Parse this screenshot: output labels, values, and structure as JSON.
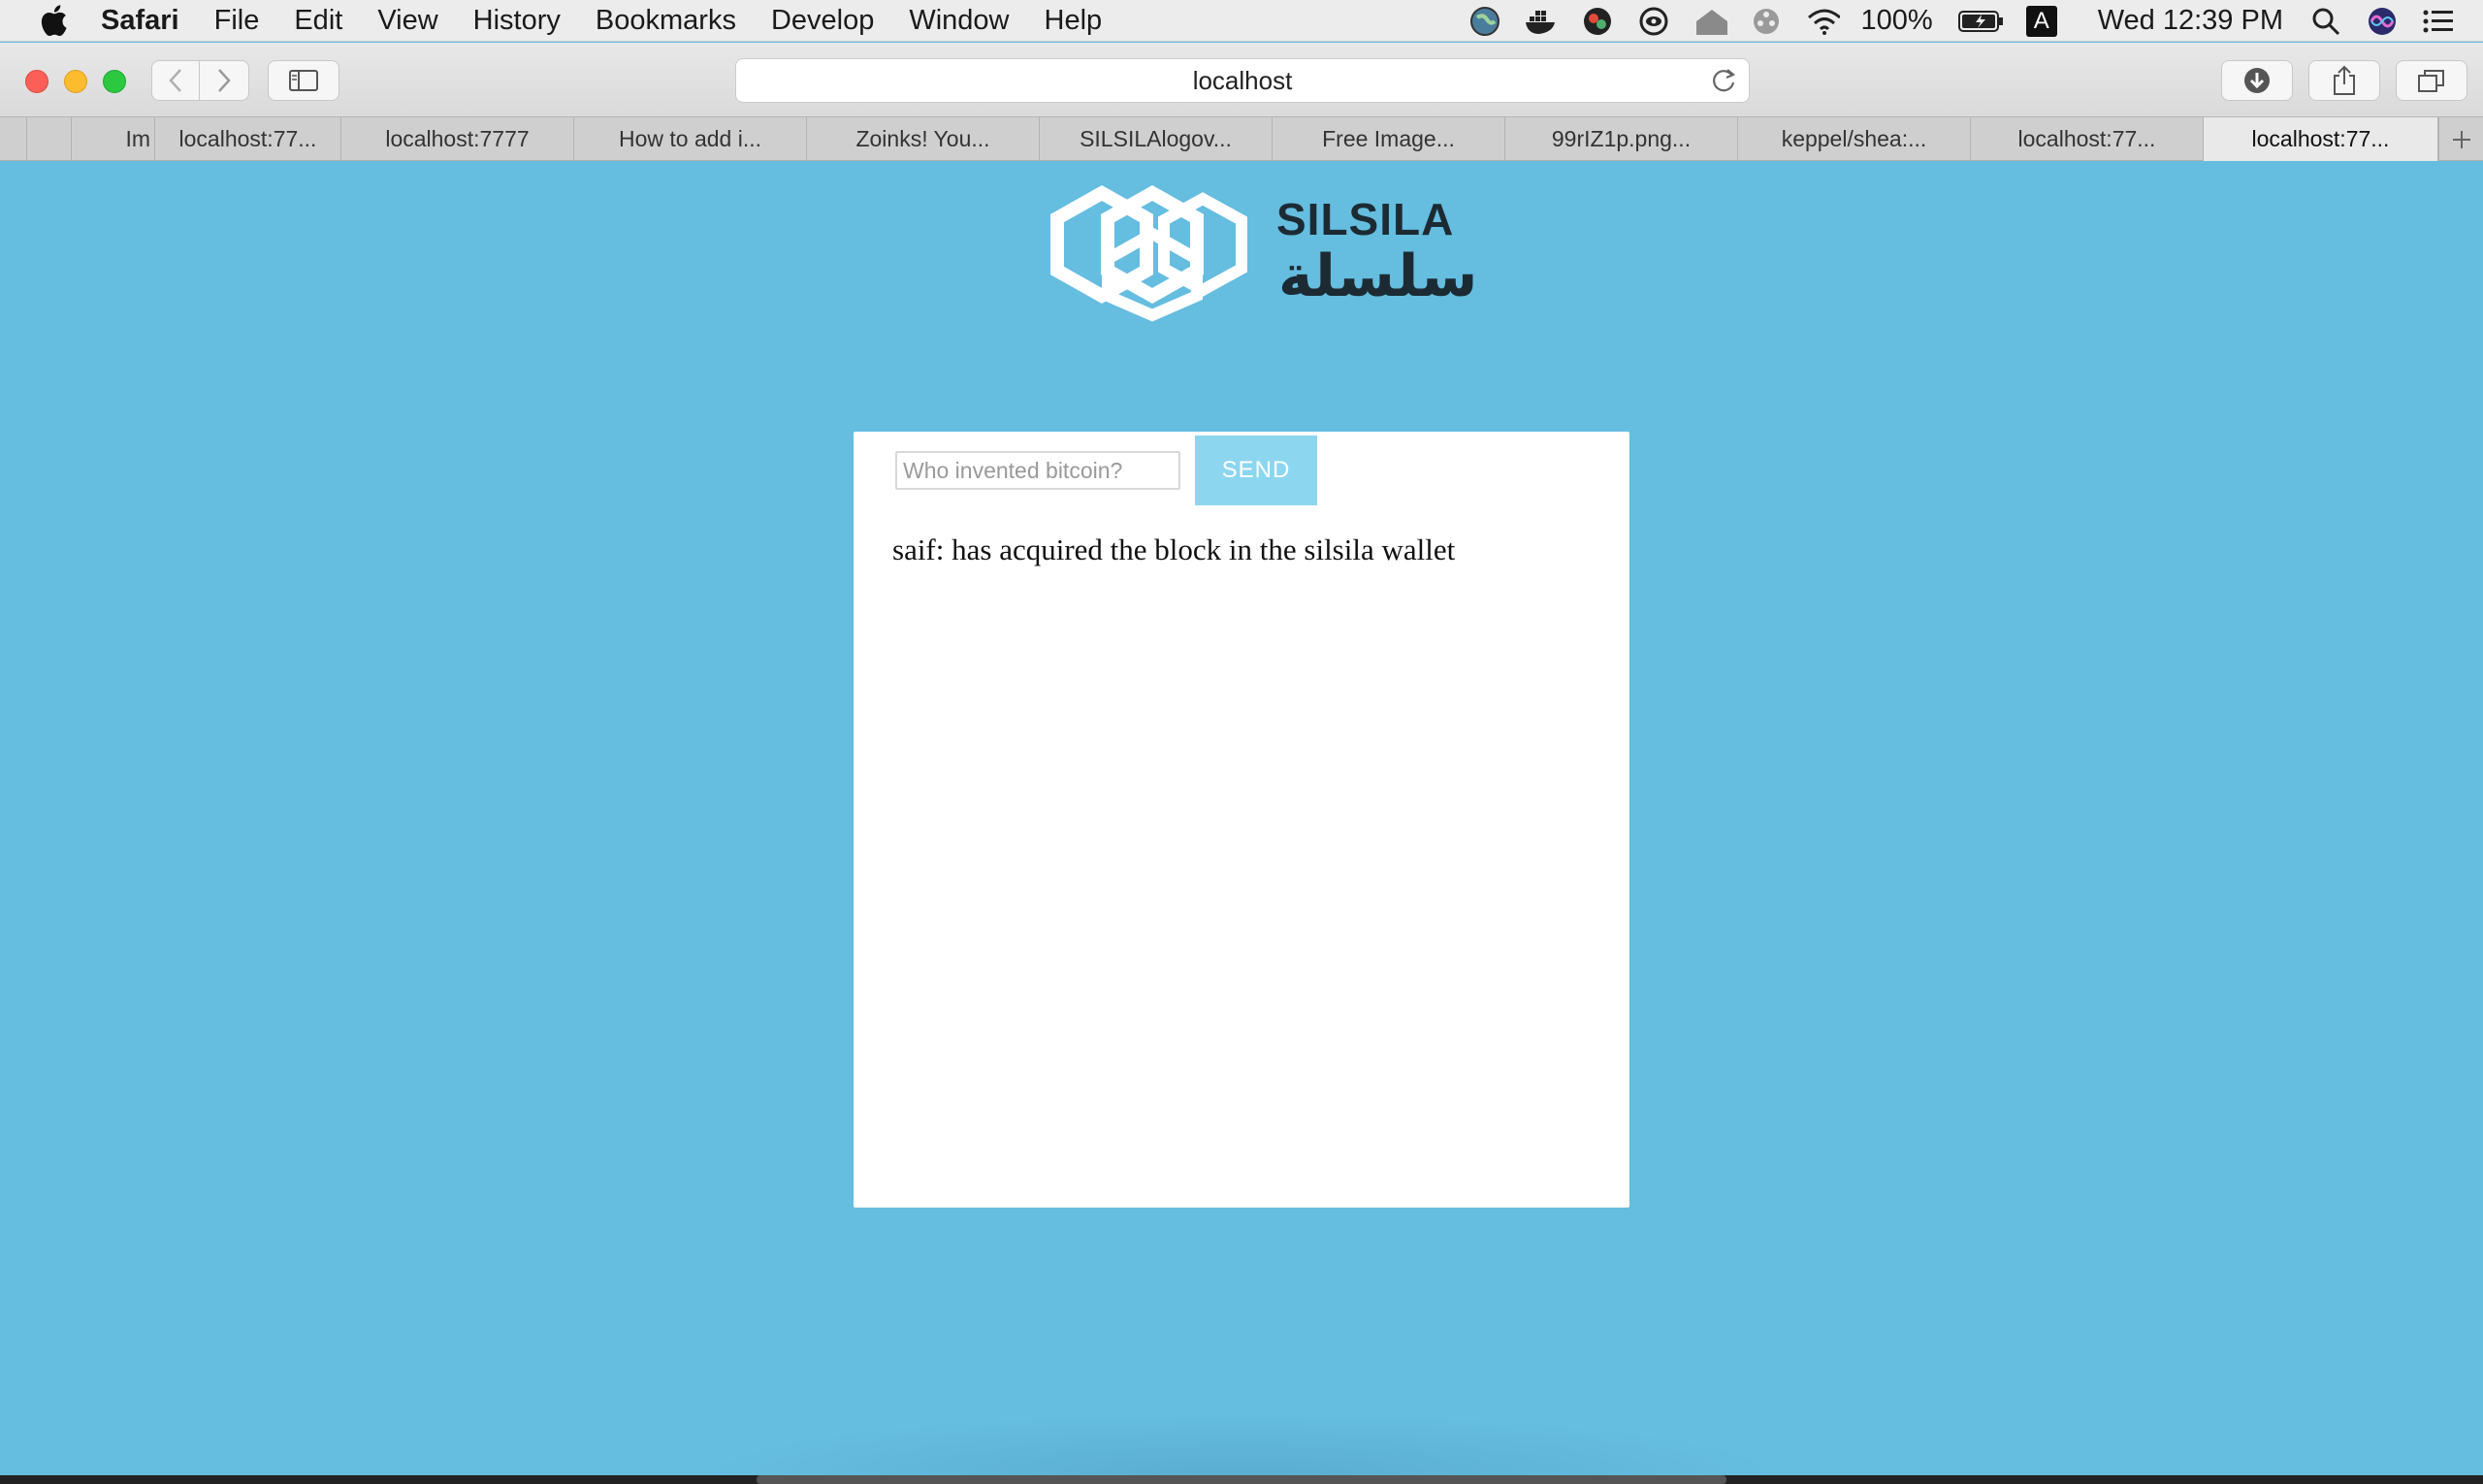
{
  "menubar": {
    "app_name": "Safari",
    "items": [
      "File",
      "Edit",
      "View",
      "History",
      "Bookmarks",
      "Develop",
      "Window",
      "Help"
    ],
    "battery": "100%",
    "input_source": "A",
    "clock": "Wed 12:39 PM",
    "status_icons": [
      "globe-icon",
      "docker-icon",
      "app-icon",
      "eye-icon",
      "home-icon",
      "film-icon",
      "wifi-icon",
      "battery-icon",
      "search-icon",
      "siri-icon",
      "list-icon"
    ]
  },
  "toolbar": {
    "address": "localhost"
  },
  "tabs": [
    {
      "label": "Im",
      "active": false
    },
    {
      "label": "localhost:77...",
      "active": false
    },
    {
      "label": "localhost:7777",
      "active": false
    },
    {
      "label": "How to add i...",
      "active": false
    },
    {
      "label": "Zoinks! You...",
      "active": false
    },
    {
      "label": "SILSILAlogov...",
      "active": false
    },
    {
      "label": "Free Image...",
      "active": false
    },
    {
      "label": "99rIZ1p.png...",
      "active": false
    },
    {
      "label": "keppel/shea:...",
      "active": false
    },
    {
      "label": "localhost:77...",
      "active": false
    },
    {
      "label": "localhost:77...",
      "active": true
    }
  ],
  "page": {
    "logo_text": "SILSILA",
    "logo_arabic": "سلسلة",
    "input_placeholder": "Who invented bitcoin?",
    "send_label": "SEND",
    "message": "saif: has acquired the block in the silsila wallet"
  },
  "colors": {
    "page_background": "#65bde0",
    "send_button": "#8cd6f0",
    "logo_dark": "#1c2b33"
  }
}
